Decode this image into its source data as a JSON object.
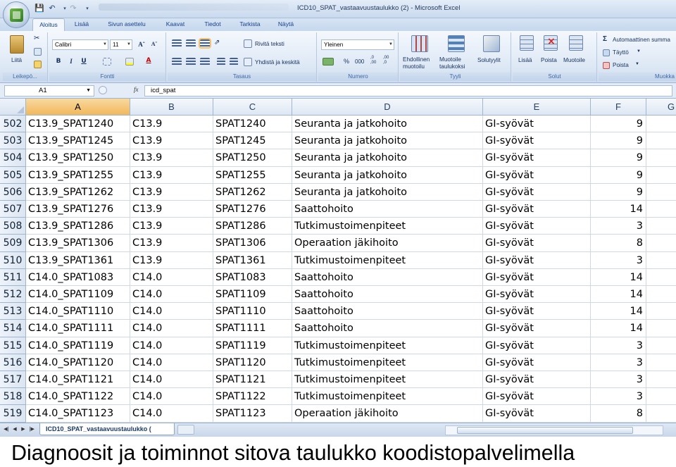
{
  "window": {
    "title": "ICD10_SPAT_vastaavuustaulukko (2) - Microsoft Excel"
  },
  "ribbon": {
    "tabs": [
      "Aloitus",
      "Lisää",
      "Sivun asettelu",
      "Kaavat",
      "Tiedot",
      "Tarkista",
      "Näytä"
    ],
    "active_tab": "Aloitus",
    "groups": {
      "clipboard": {
        "label": "Leikepö...",
        "paste": "Liitä"
      },
      "font": {
        "label": "Fontti",
        "font_name": "Calibri",
        "font_size": "11",
        "bold": "B",
        "italic": "I",
        "underline": "U"
      },
      "alignment": {
        "label": "Tasaus",
        "wrap_text": "Rivitä teksti",
        "merge_center": "Yhdistä ja keskitä"
      },
      "number": {
        "label": "Numero",
        "format": "Yleinen",
        "percent": "%",
        "thousands": "000"
      },
      "styles": {
        "label": "Tyyli",
        "conditional": "Ehdollinen muotoilu",
        "format_table": "Muotoile taulukoksi",
        "cell_styles": "Solutyylit"
      },
      "cells": {
        "label": "Solut",
        "insert": "Lisää",
        "delete": "Poista",
        "format": "Muotoile"
      },
      "editing": {
        "label": "Muokka",
        "autosum": "Automaattinen summa",
        "fill": "Täyttö",
        "clear": "Poista"
      }
    }
  },
  "formula_bar": {
    "name_box": "A1",
    "fx": "fx",
    "formula": "icd_spat"
  },
  "grid": {
    "columns": [
      "A",
      "B",
      "C",
      "D",
      "E",
      "F",
      "G"
    ],
    "selected_column": "A",
    "rows": [
      {
        "num": "502",
        "a": "C13.9_SPAT1240",
        "b": "C13.9",
        "c": "SPAT1240",
        "d": "Seuranta ja jatkohoito",
        "e": "GI-syövät",
        "f": "9"
      },
      {
        "num": "503",
        "a": "C13.9_SPAT1245",
        "b": "C13.9",
        "c": "SPAT1245",
        "d": "Seuranta ja jatkohoito",
        "e": "GI-syövät",
        "f": "9"
      },
      {
        "num": "504",
        "a": "C13.9_SPAT1250",
        "b": "C13.9",
        "c": "SPAT1250",
        "d": "Seuranta ja jatkohoito",
        "e": "GI-syövät",
        "f": "9"
      },
      {
        "num": "505",
        "a": "C13.9_SPAT1255",
        "b": "C13.9",
        "c": "SPAT1255",
        "d": "Seuranta ja jatkohoito",
        "e": "GI-syövät",
        "f": "9"
      },
      {
        "num": "506",
        "a": "C13.9_SPAT1262",
        "b": "C13.9",
        "c": "SPAT1262",
        "d": "Seuranta ja jatkohoito",
        "e": "GI-syövät",
        "f": "9"
      },
      {
        "num": "507",
        "a": "C13.9_SPAT1276",
        "b": "C13.9",
        "c": "SPAT1276",
        "d": "Saattohoito",
        "e": "GI-syövät",
        "f": "14"
      },
      {
        "num": "508",
        "a": "C13.9_SPAT1286",
        "b": "C13.9",
        "c": "SPAT1286",
        "d": "Tutkimustoimenpiteet",
        "e": "GI-syövät",
        "f": "3"
      },
      {
        "num": "509",
        "a": "C13.9_SPAT1306",
        "b": "C13.9",
        "c": "SPAT1306",
        "d": "Operaation jäkihoito",
        "e": "GI-syövät",
        "f": "8"
      },
      {
        "num": "510",
        "a": "C13.9_SPAT1361",
        "b": "C13.9",
        "c": "SPAT1361",
        "d": "Tutkimustoimenpiteet",
        "e": "GI-syövät",
        "f": "3"
      },
      {
        "num": "511",
        "a": "C14.0_SPAT1083",
        "b": "C14.0",
        "c": "SPAT1083",
        "d": "Saattohoito",
        "e": "GI-syövät",
        "f": "14"
      },
      {
        "num": "512",
        "a": "C14.0_SPAT1109",
        "b": "C14.0",
        "c": "SPAT1109",
        "d": "Saattohoito",
        "e": "GI-syövät",
        "f": "14"
      },
      {
        "num": "513",
        "a": "C14.0_SPAT1110",
        "b": "C14.0",
        "c": "SPAT1110",
        "d": "Saattohoito",
        "e": "GI-syövät",
        "f": "14"
      },
      {
        "num": "514",
        "a": "C14.0_SPAT1111",
        "b": "C14.0",
        "c": "SPAT1111",
        "d": "Saattohoito",
        "e": "GI-syövät",
        "f": "14"
      },
      {
        "num": "515",
        "a": "C14.0_SPAT1119",
        "b": "C14.0",
        "c": "SPAT1119",
        "d": "Tutkimustoimenpiteet",
        "e": "GI-syövät",
        "f": "3"
      },
      {
        "num": "516",
        "a": "C14.0_SPAT1120",
        "b": "C14.0",
        "c": "SPAT1120",
        "d": "Tutkimustoimenpiteet",
        "e": "GI-syövät",
        "f": "3"
      },
      {
        "num": "517",
        "a": "C14.0_SPAT1121",
        "b": "C14.0",
        "c": "SPAT1121",
        "d": "Tutkimustoimenpiteet",
        "e": "GI-syövät",
        "f": "3"
      },
      {
        "num": "518",
        "a": "C14.0_SPAT1122",
        "b": "C14.0",
        "c": "SPAT1122",
        "d": "Tutkimustoimenpiteet",
        "e": "GI-syövät",
        "f": "3"
      },
      {
        "num": "519",
        "a": "C14.0_SPAT1123",
        "b": "C14.0",
        "c": "SPAT1123",
        "d": "Operaation jäkihoito",
        "e": "GI-syövät",
        "f": "8"
      }
    ]
  },
  "sheet_tabs": {
    "active": "ICD10_SPAT_vastaavuustaulukko ("
  },
  "caption": "Diagnoosit ja toiminnot sitova taulukko koodistopalvelimella",
  "colors": {
    "selected_header": "#f1b85a",
    "ribbon_text": "#15428b",
    "gridline": "#d0d7e5"
  }
}
